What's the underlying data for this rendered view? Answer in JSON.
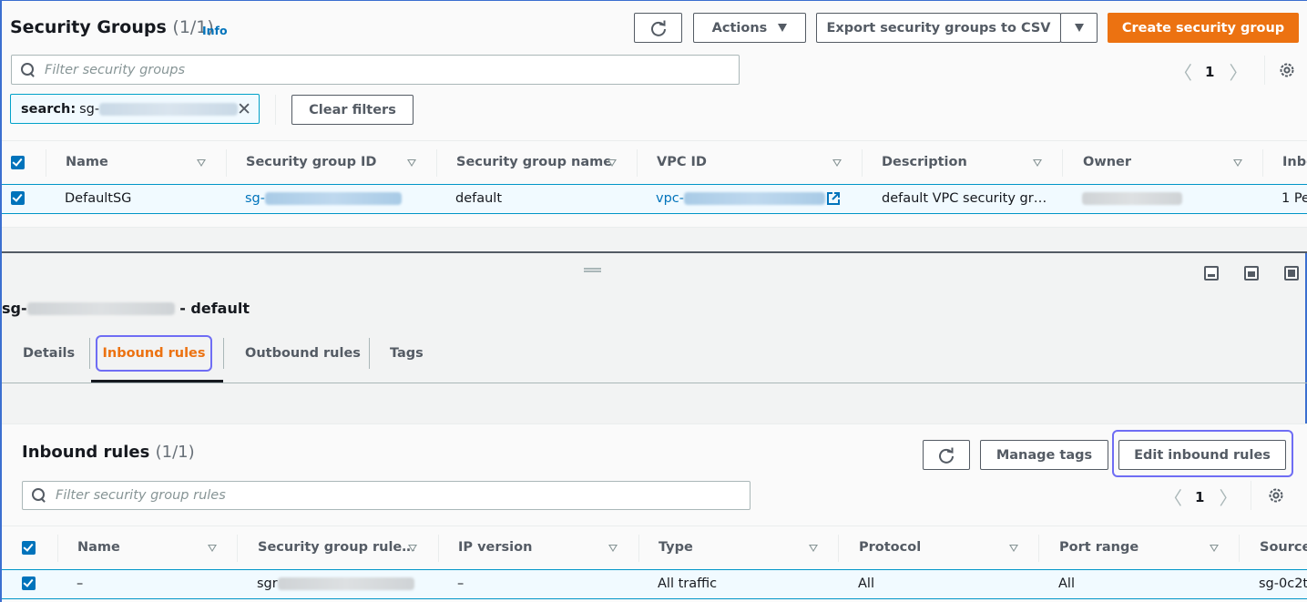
{
  "security_groups": {
    "title": "Security Groups",
    "count": "(1/1)",
    "info_label": "Info",
    "refresh_icon": "refresh-icon",
    "actions_label": "Actions",
    "export_label": "Export security groups to CSV",
    "create_label": "Create security group",
    "search_placeholder": "Filter security groups",
    "page": "1",
    "filter_token": {
      "key": "search:",
      "value_prefix": "sg-"
    },
    "clear_filters_label": "Clear filters",
    "columns": [
      "Name",
      "Security group ID",
      "Security group name",
      "VPC ID",
      "Description",
      "Owner",
      "Inbo"
    ],
    "rows": [
      {
        "name": "DefaultSG",
        "sg_id_prefix": "sg-",
        "sg_name": "default",
        "vpc_id_prefix": "vpc-",
        "description": "default VPC security gr…",
        "owner": "",
        "inbound": "1 Pe"
      }
    ]
  },
  "detail": {
    "title_prefix": "sg-",
    "title_suffix": " - default",
    "tabs": [
      {
        "label": "Details",
        "active": false
      },
      {
        "label": "Inbound rules",
        "active": true
      },
      {
        "label": "Outbound rules",
        "active": false
      },
      {
        "label": "Tags",
        "active": false
      }
    ]
  },
  "inbound_rules": {
    "title": "Inbound rules",
    "count": "(1/1)",
    "manage_tags_label": "Manage tags",
    "edit_label": "Edit inbound rules",
    "search_placeholder": "Filter security group rules",
    "page": "1",
    "columns": [
      "Name",
      "Security group rule…",
      "IP version",
      "Type",
      "Protocol",
      "Port range",
      "Source"
    ],
    "rows": [
      {
        "name": "–",
        "rule_id_prefix": "sgr",
        "ip_version": "–",
        "type": "All traffic",
        "protocol": "All",
        "port_range": "All",
        "source": "sg-0c2t"
      }
    ]
  },
  "colors": {
    "primary": "#ec7211",
    "link": "#0073bb",
    "focus": "#6f6df4",
    "selected_row_bg": "#f1faff"
  }
}
